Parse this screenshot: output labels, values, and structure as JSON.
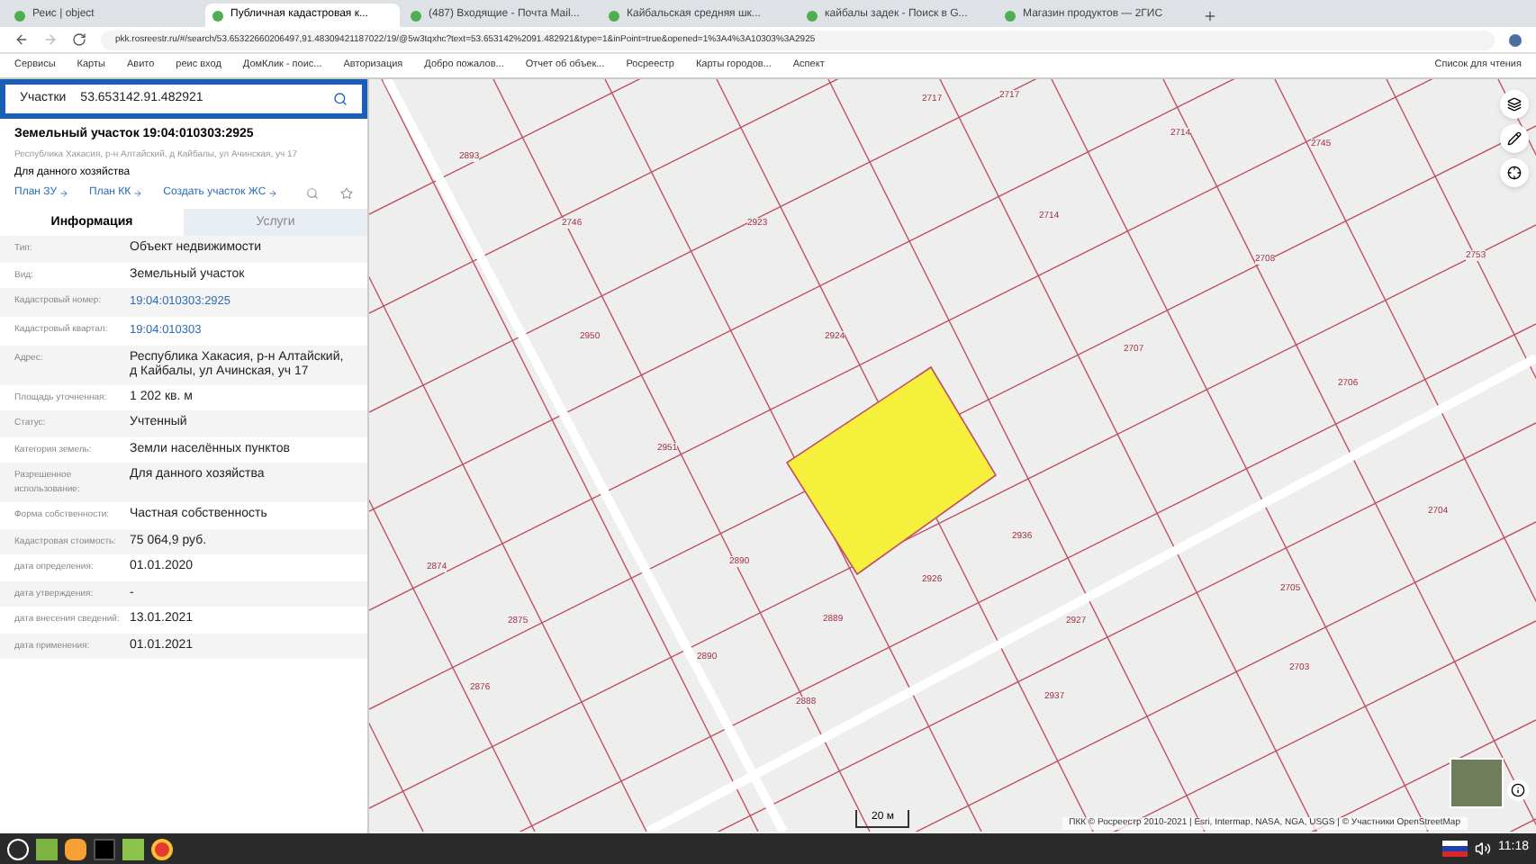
{
  "browser": {
    "tabs": [
      {
        "title": "Реис | object",
        "selected": false
      },
      {
        "title": "Публичная кадастровая к...",
        "selected": true
      },
      {
        "title": "(487) Входящие - Почта Mail...",
        "selected": false
      },
      {
        "title": "Кайбальская средняя шк...",
        "selected": false
      },
      {
        "title": "кайбалы задек - Поиск в G...",
        "selected": false
      },
      {
        "title": "Магазин продуктов — 2ГИС",
        "selected": false
      }
    ],
    "address": "pkk.rosreestr.ru/#/search/53.65322660206497,91.48309421187022/19/@5w3tqxhc?text=53.653142%2091.482921&type=1&inPoint=true&opened=1%3A4%3A10303%3A2925",
    "bookmarks": [
      "Сервисы",
      "Карты",
      "Авито",
      "реис вход",
      "ДомКлик - поис...",
      "Авторизация",
      "Добро пожалов...",
      "Отчет об объек...",
      "Росреестр",
      "Карты городов...",
      "Аспект"
    ],
    "reading_list": "Список для чтения"
  },
  "panel": {
    "search": {
      "layer": "Участки",
      "value": "53.653142.91.482921"
    },
    "title": "Земельный участок 19:04:010303:2925",
    "address": "Республика Хакасия, р-н Алтайский, д Кайбалы, ул Ачинская, уч 17",
    "purpose": "Для данного хозяйства",
    "links": [
      "План ЗУ",
      "План КК",
      "Создать участок ЖС"
    ],
    "tabs": [
      {
        "label": "Информация",
        "selected": true
      },
      {
        "label": "Услуги",
        "selected": false
      }
    ],
    "rows": [
      {
        "label": "Тип:",
        "value": "Объект недвижимости",
        "kind": "text"
      },
      {
        "label": "Вид:",
        "value": "Земельный участок",
        "kind": "text"
      },
      {
        "label": "Кадастровый номер:",
        "value": "19:04:010303:2925",
        "kind": "link"
      },
      {
        "label": "Кадастровый квартал:",
        "value": "19:04:010303",
        "kind": "link"
      },
      {
        "label": "Адрес:",
        "value": "Республика Хакасия, р-н Алтайский, д Кайбалы, ул Ачинская, уч 17",
        "kind": "text"
      },
      {
        "label": "Площадь уточненная:",
        "value": "1 202 кв. м",
        "kind": "text"
      },
      {
        "label": "Статус:",
        "value": "Учтенный",
        "kind": "text"
      },
      {
        "label": "Категория земель:",
        "value": "Земли населённых пунктов",
        "kind": "text"
      },
      {
        "label": "Разрешенное использование:",
        "value": "Для данного хозяйства",
        "kind": "text"
      },
      {
        "label": "Форма собственности:",
        "value": "Частная собственность",
        "kind": "text"
      },
      {
        "label": "Кадастровая стоимость:",
        "value": "75 064,9 руб.",
        "kind": "text"
      },
      {
        "label": "дата определения:",
        "value": "01.01.2020",
        "kind": "text"
      },
      {
        "label": "дата утверждения:",
        "value": "-",
        "kind": "text"
      },
      {
        "label": "дата внесения сведений:",
        "value": "13.01.2021",
        "kind": "text"
      },
      {
        "label": "дата применения:",
        "value": "01.01.2021",
        "kind": "text"
      }
    ]
  },
  "map": {
    "labels": [
      "2893",
      "2746",
      "2923",
      "2717",
      "2717",
      "2714",
      "2745",
      "2714",
      "2950",
      "2924",
      "2708",
      "2707",
      "2951",
      "2706",
      "2874",
      "2890",
      "2926",
      "2936",
      "2704",
      "2875",
      "2889",
      "2890",
      "2927",
      "2705",
      "2703",
      "2876",
      "2888",
      "2937",
      "2753"
    ],
    "scale": "20 м",
    "attribution": "ПКК © Росреестр 2010-2021 | Esri, Intermap, NASA, NGA, USGS | © Участники OpenStreetMap"
  },
  "taskbar": {
    "time": "11:18"
  }
}
